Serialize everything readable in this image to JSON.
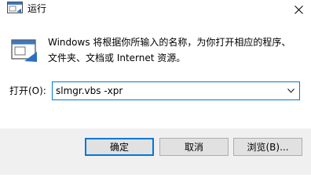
{
  "window": {
    "title": "运行",
    "close_icon": "close-icon",
    "app_icon": "run-app-icon"
  },
  "description": "Windows 将根据你所输入的名称，为你打开相应的程序、文件夹、文档或 Internet 资源。",
  "open_field": {
    "label": "打开(O):",
    "value": "slmgr.vbs -xpr",
    "dropdown_icon": "chevron-down-icon"
  },
  "buttons": {
    "ok": "确定",
    "cancel": "取消",
    "browse": "浏览(B)..."
  },
  "colors": {
    "accent": "#0078d7",
    "footer_bg": "#f0f0f0",
    "button_bg": "#e1e1e1"
  }
}
